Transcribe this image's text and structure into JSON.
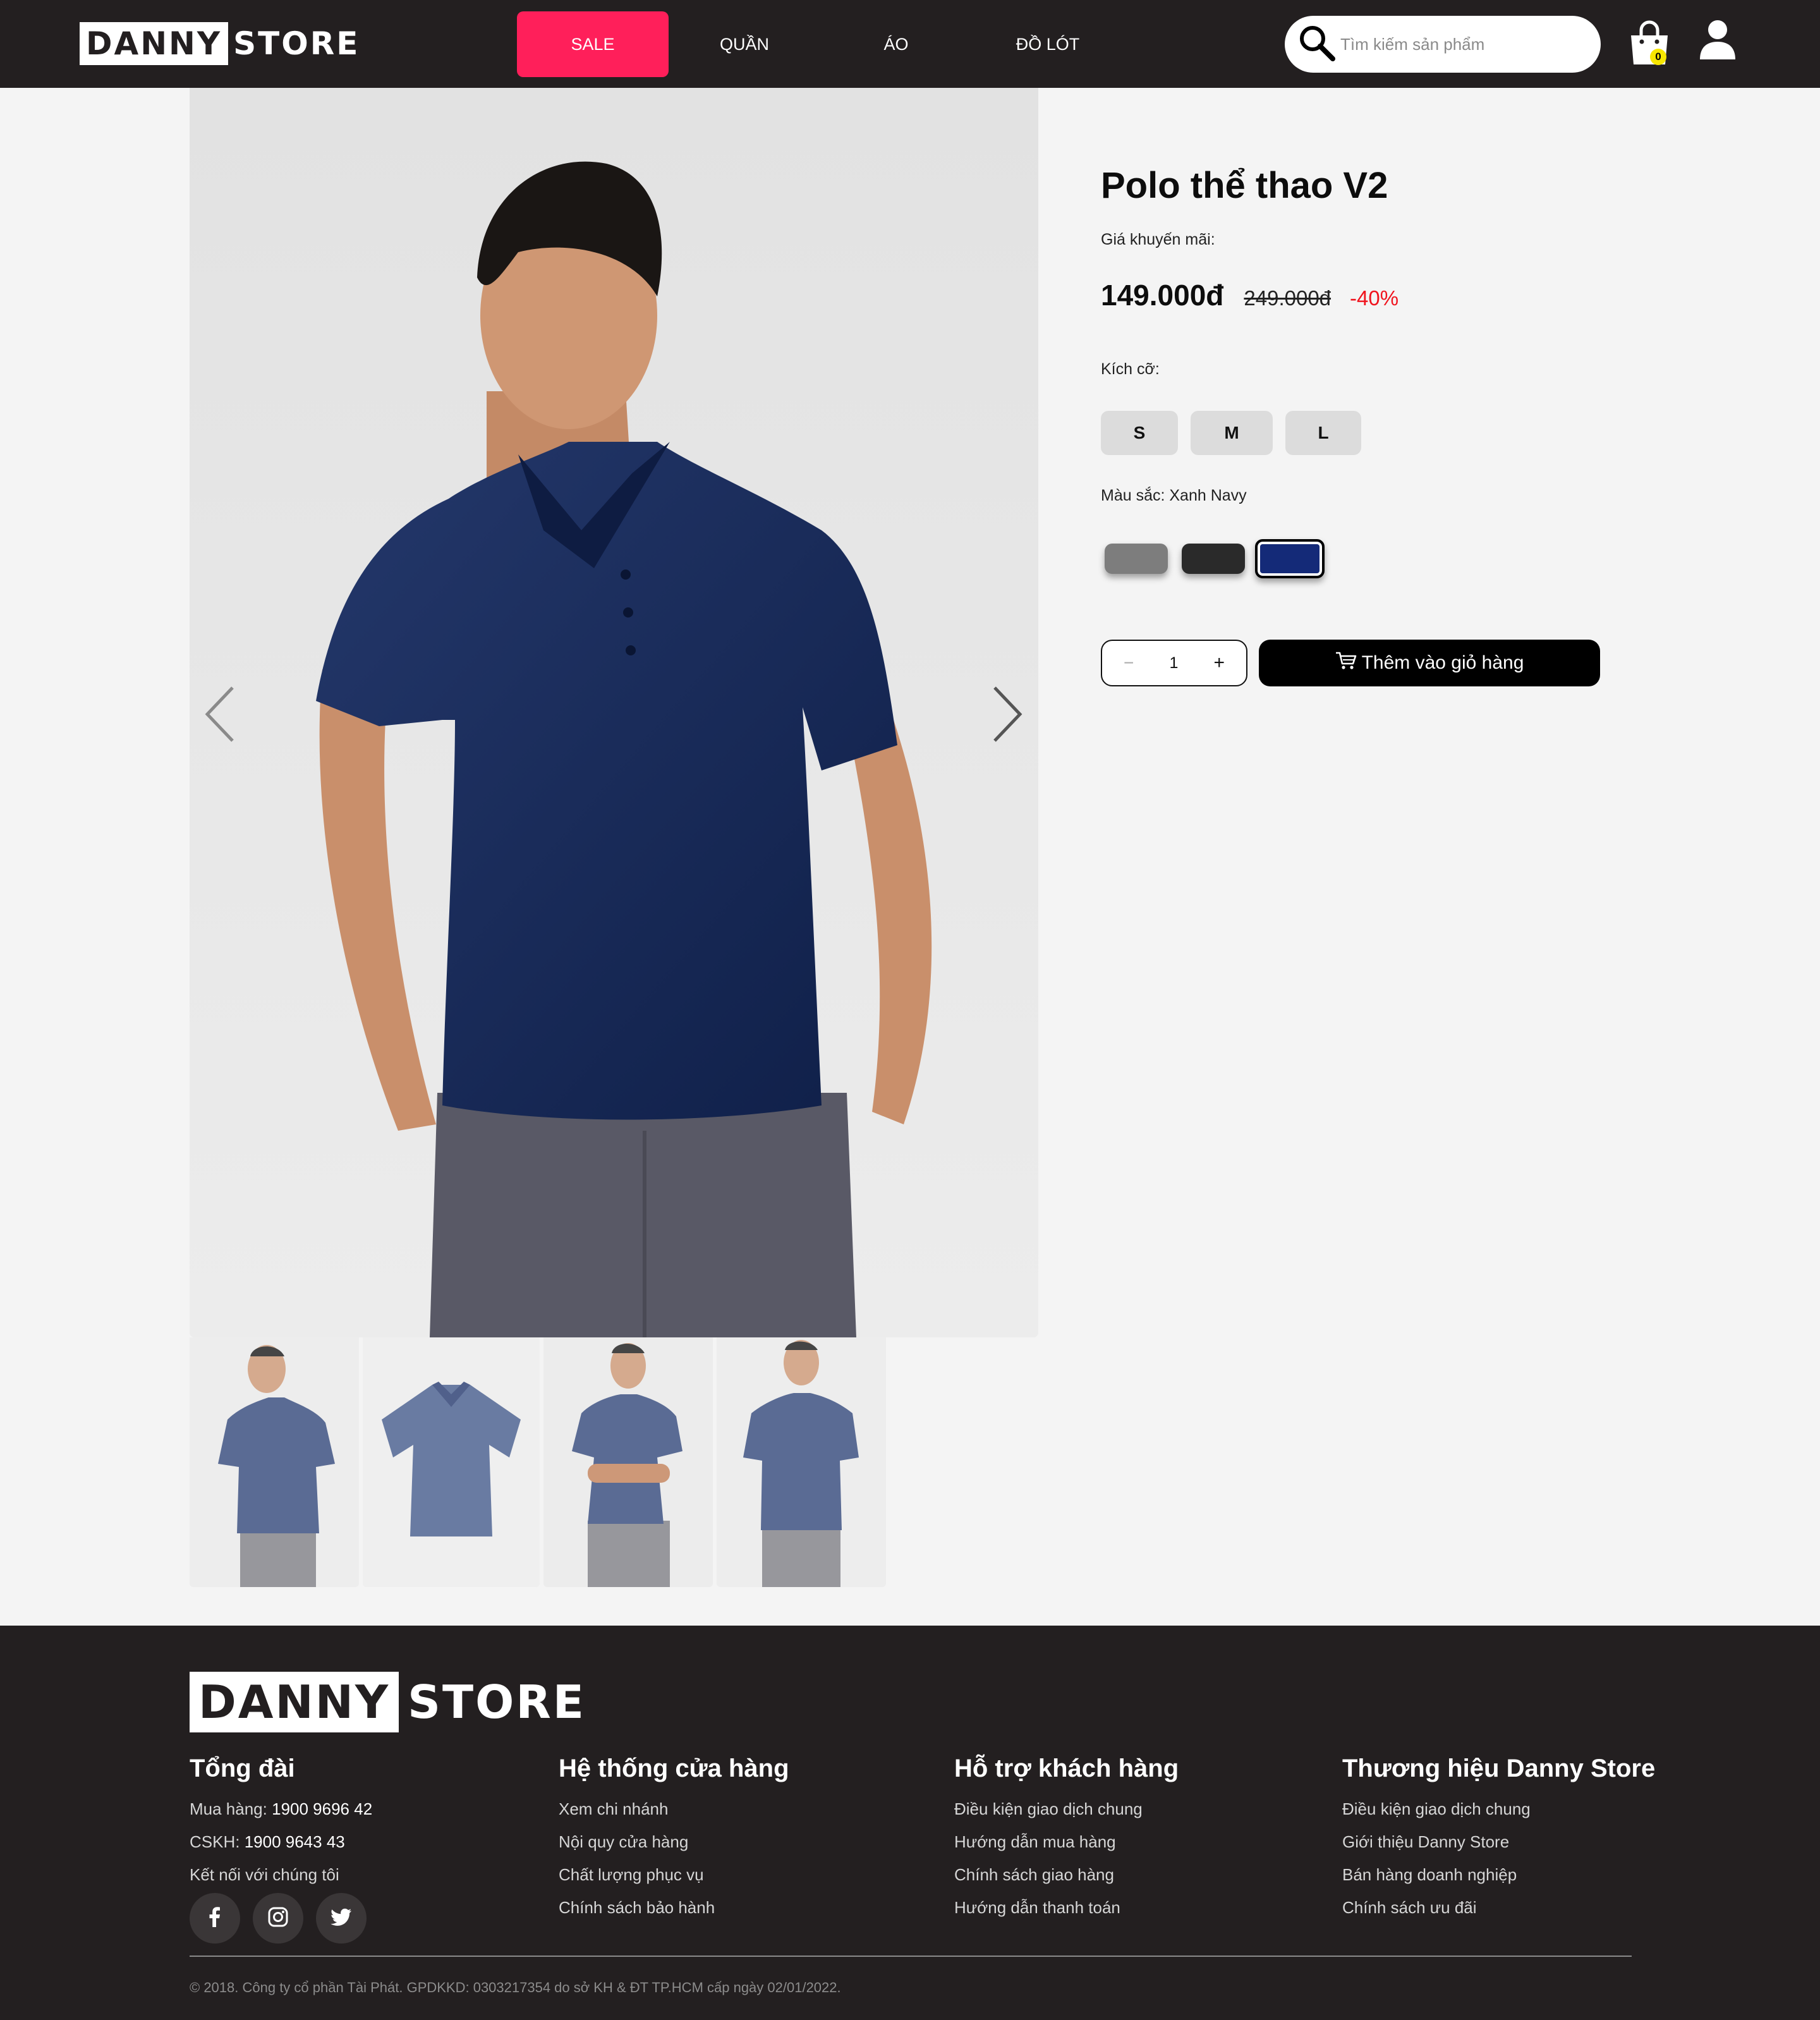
{
  "header": {
    "logo_box": "DANNY",
    "logo_rest": "STORE",
    "nav": [
      {
        "label": "SALE"
      },
      {
        "label": "QUẦN"
      },
      {
        "label": "ÁO"
      },
      {
        "label": "ĐỒ LÓT"
      }
    ],
    "search_placeholder": "Tìm kiếm sản phẩm",
    "cart_count": "0",
    "icons": {
      "search": "search-icon",
      "cart": "shopping-bag-icon",
      "user": "user-icon"
    },
    "sale_color": "#ff1f5a"
  },
  "product": {
    "title": "Polo thể thao V2",
    "promo_label": "Giá khuyến mãi:",
    "price": "149.000đ",
    "old_price": "249.000đ",
    "discount": "-40%",
    "size_label": "Kích cỡ:",
    "sizes": [
      "S",
      "M",
      "L"
    ],
    "color_label": "Màu sắc: Xanh Navy",
    "colors": [
      {
        "name": "Xám",
        "hex": "#7d7d7d"
      },
      {
        "name": "Đen",
        "hex": "#2a2a2a"
      },
      {
        "name": "Xanh Navy",
        "hex": "#142a78",
        "selected": true
      }
    ],
    "quantity": "1",
    "quantity_minus": "−",
    "quantity_plus": "+",
    "add_to_cart": "Thêm vào giỏ hàng",
    "thumbnail_count": 4
  },
  "footer": {
    "logo_box": "DANNY",
    "logo_rest": "STORE",
    "hotline": {
      "title": "Tổng đài",
      "buy_label": "Mua hàng:",
      "buy_number": "1900 9696 42",
      "care_label": "CSKH:",
      "care_number": "1900 9643 43",
      "connect": "Kết nối với chúng tôi",
      "socials": [
        "facebook-icon",
        "instagram-icon",
        "twitter-icon"
      ]
    },
    "stores": {
      "title": "Hệ thống cửa hàng",
      "links": [
        "Xem chi nhánh",
        "Nội quy cửa hàng",
        "Chất lượng phục vụ",
        "Chính sách bảo hành"
      ]
    },
    "support": {
      "title": "Hỗ trợ khách hàng",
      "links": [
        "Điều kiện giao dịch chung",
        "Hướng dẫn mua hàng",
        "Chính sách giao hàng",
        "Hướng dẫn thanh toán"
      ]
    },
    "brand": {
      "title": "Thương hiệu Danny Store",
      "links": [
        "Điều kiện giao dịch chung",
        "Giới thiệu Danny Store",
        "Bán hàng doanh nghiệp",
        "Chính sách ưu đãi"
      ]
    },
    "copyright": "© 2018. Công ty cổ phần Tài Phát. GPDKKD: 0303217354 do sở KH & ĐT TP.HCM cấp ngày 02/01/2022."
  }
}
